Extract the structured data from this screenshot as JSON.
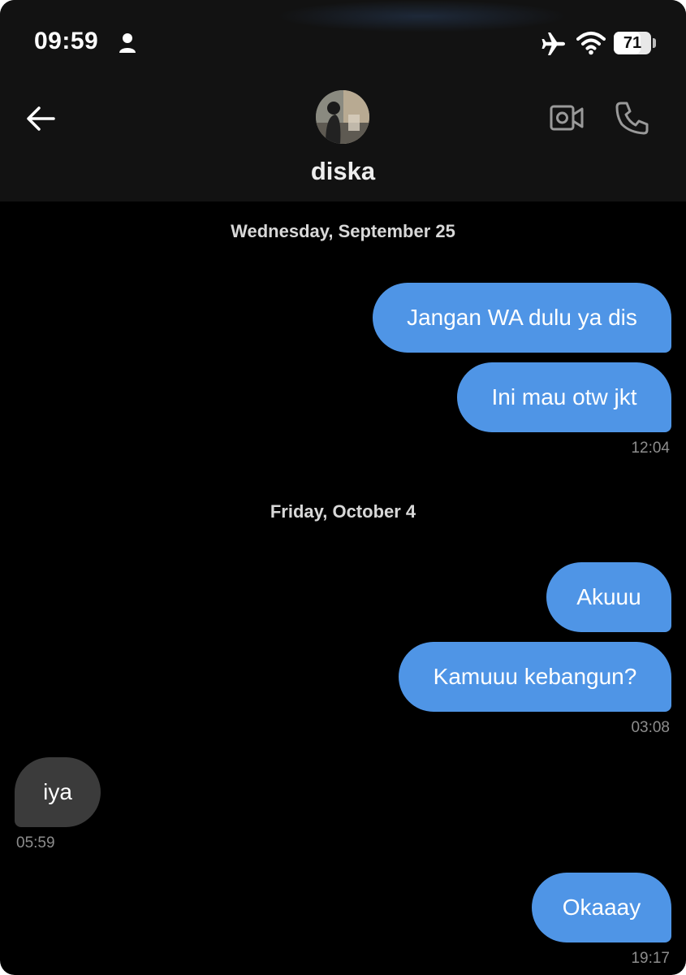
{
  "status_bar": {
    "time": "09:59",
    "battery_level": "71",
    "battery_percent": 71,
    "icons": [
      "person-icon",
      "airplane-icon",
      "wifi-icon",
      "battery-icon"
    ]
  },
  "header": {
    "contact_name": "diska",
    "icons": [
      "back-arrow-icon",
      "avatar",
      "video-call-icon",
      "phone-call-icon"
    ]
  },
  "conversation": {
    "day1": {
      "date": "Wednesday, September 25",
      "messages": [
        {
          "direction": "outgoing",
          "text": "Jangan WA dulu ya dis"
        },
        {
          "direction": "outgoing",
          "text": "Ini mau otw jkt"
        }
      ],
      "time": "12:04"
    },
    "day2": {
      "date": "Friday, October 4",
      "group1": {
        "messages": [
          {
            "direction": "outgoing",
            "text": "Akuuu"
          },
          {
            "direction": "outgoing",
            "text": "Kamuuu kebangun?"
          }
        ],
        "time": "03:08"
      },
      "group2": {
        "messages": [
          {
            "direction": "incoming",
            "text": "iya"
          }
        ],
        "time": "05:59"
      },
      "group3": {
        "messages": [
          {
            "direction": "outgoing",
            "text": "Okaaay"
          }
        ],
        "time": "19:17"
      }
    }
  },
  "colors": {
    "outgoing_bubble": "#4f95e6",
    "incoming_bubble": "#3b3b3b",
    "background": "#000000",
    "header": "#121212"
  }
}
